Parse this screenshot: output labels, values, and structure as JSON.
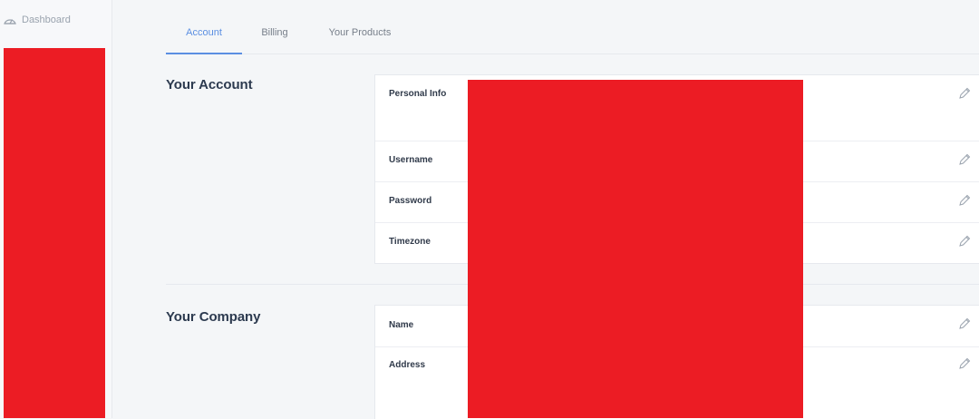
{
  "sidebar": {
    "dashboard_label": "Dashboard",
    "dashboard_icon": "gauge-icon"
  },
  "tabs": [
    {
      "label": "Account",
      "active": true
    },
    {
      "label": "Billing",
      "active": false
    },
    {
      "label": "Your Products",
      "active": false
    }
  ],
  "account_section": {
    "title": "Your Account",
    "rows": [
      {
        "label": "Personal Info",
        "icon": "pencil-icon"
      },
      {
        "label": "Username",
        "icon": "pencil-icon"
      },
      {
        "label": "Password",
        "icon": "pencil-icon"
      },
      {
        "label": "Timezone",
        "icon": "pencil-icon"
      }
    ]
  },
  "company_section": {
    "title": "Your Company",
    "rows": [
      {
        "label": "Name",
        "icon": "pencil-icon"
      },
      {
        "label": "Address",
        "icon": "pencil-icon"
      }
    ]
  },
  "colors": {
    "accent": "#5b8fe2",
    "redaction": "#ec1c24",
    "background": "#f4f6f8"
  }
}
